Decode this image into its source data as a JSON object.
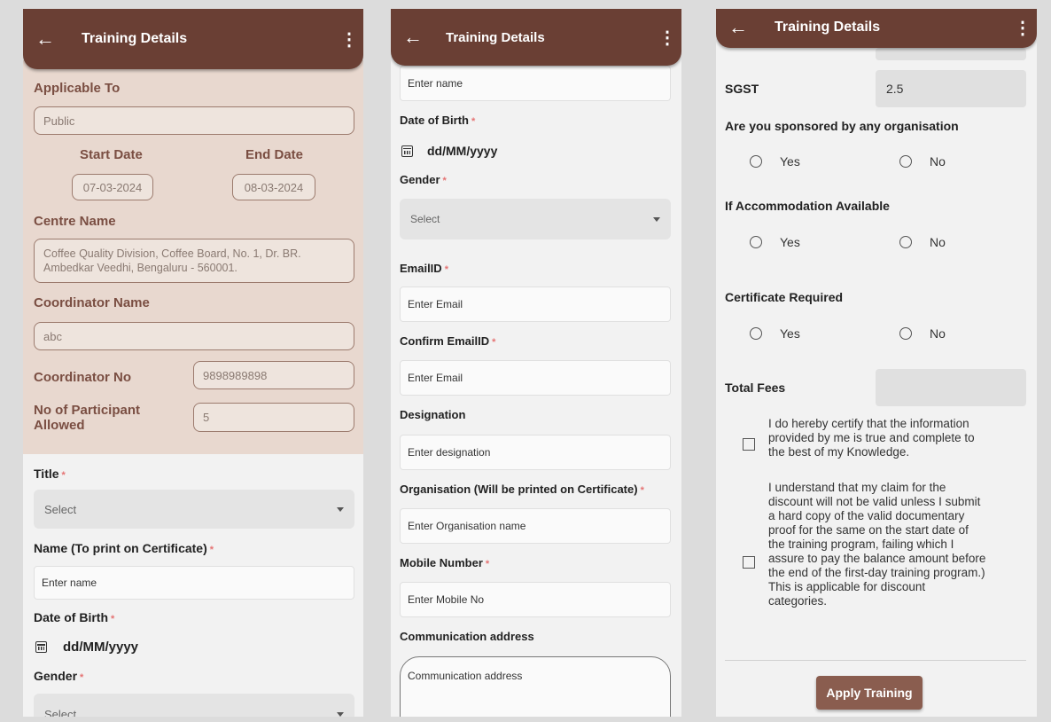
{
  "appbar": {
    "title": "Training Details"
  },
  "screen1": {
    "applicable_to_label": "Applicable To",
    "applicable_to_value": "Public",
    "start_date_label": "Start Date",
    "end_date_label": "End Date",
    "start_date": "07-03-2024",
    "end_date": "08-03-2024",
    "centre_name_label": "Centre Name",
    "centre_name_line1": "Coffee Quality Division, Coffee Board, No. 1, Dr. BR.",
    "centre_name_line2": "Ambedkar Veedhi, Bengaluru - 560001.",
    "coordinator_name_label": "Coordinator Name",
    "coordinator_name_value": "abc",
    "coordinator_no_label": "Coordinator No",
    "coordinator_no_value": "9898989898",
    "participants_label_line1": "No of Participant",
    "participants_label_line2": "Allowed",
    "participants_value": "5",
    "title_label": "Title",
    "title_select": "Select",
    "name_label": "Name (To print on Certificate)",
    "name_placeholder": "Enter name",
    "dob_label": "Date of Birth",
    "dob_placeholder": "dd/MM/yyyy",
    "gender_label": "Gender",
    "gender_select": "Select"
  },
  "screen2": {
    "name_placeholder": "Enter name",
    "dob_label": "Date of Birth",
    "dob_placeholder": "dd/MM/yyyy",
    "gender_label": "Gender",
    "gender_select": "Select",
    "email_label": "EmailID",
    "email_placeholder": "Enter Email",
    "confirm_email_label": "Confirm EmailID",
    "confirm_email_placeholder": "Enter Email",
    "designation_label": "Designation",
    "designation_placeholder": "Enter designation",
    "organisation_label": "Organisation (Will be printed on Certificate)",
    "organisation_placeholder": "Enter Organisation name",
    "mobile_label": "Mobile Number",
    "mobile_placeholder": "Enter Mobile No",
    "address_label": "Communication address",
    "address_placeholder": "Communication address"
  },
  "screen3": {
    "sgst_label": "SGST",
    "sgst_value": "2.5",
    "sponsored_label": "Are you sponsored by any organisation",
    "accommodation_label": "If Accommodation Available",
    "certificate_label": "Certificate Required",
    "yes": "Yes",
    "no": "No",
    "total_fees_label": "Total Fees",
    "declaration1": [
      "I do hereby certify that the information",
      "provided by me is true and complete to",
      "the best of my Knowledge."
    ],
    "declaration2": [
      "I understand that my claim for the",
      "discount will not be valid unless I submit",
      "a hard copy of the valid documentary",
      "proof for the same on the start date of",
      "the training program, failing which I",
      "assure to pay the balance amount before",
      "the end of the first-day training program.)",
      "This is applicable for discount",
      "categories."
    ],
    "apply_button": "Apply Training"
  },
  "required_mark": "*"
}
